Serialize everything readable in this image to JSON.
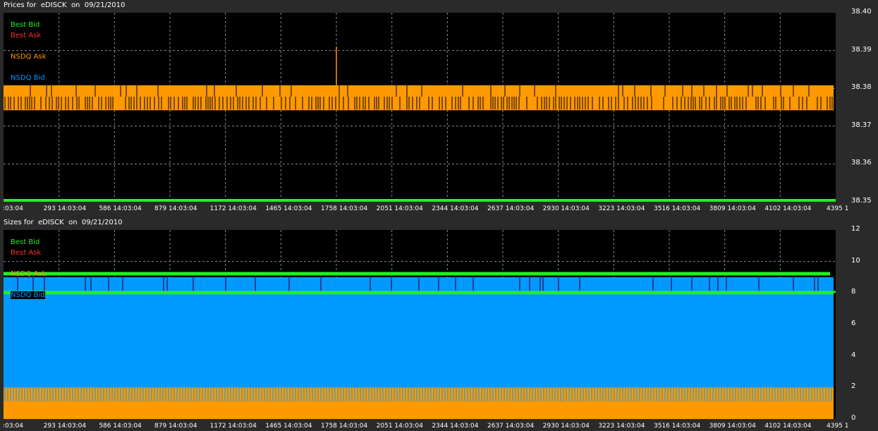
{
  "colors": {
    "background": "#2a2a2a",
    "plot_bg": "#000000",
    "grid": "#8a8a8a",
    "best_bid": "#22ee22",
    "best_ask": "#ff3030",
    "nsdq_ask": "#ff9900",
    "nsdq_bid": "#0099ff"
  },
  "chart_data": [
    {
      "type": "line",
      "title": "Prices for  eDISCK  on  09/21/2010",
      "legend": [
        "Best Bid",
        "Best Ask",
        "NSDQ Ask",
        "NSDQ Bid"
      ],
      "legend_placement": "top-left",
      "grid": true,
      "ylim": [
        38.35,
        38.4
      ],
      "y_ticks": [
        "38.40",
        "38.39",
        "38.38",
        "38.37",
        "38.36",
        "38.35"
      ],
      "x_ticks": [
        ":03:04",
        "293 14:03:04",
        "586 14:03:04",
        "879 14:03:04",
        "1172 14:03:04",
        "1465 14:03:04",
        "1758 14:03:04",
        "2051 14:03:04",
        "2344 14:03:04",
        "2637 14:03:04",
        "2930 14:03:04",
        "3223 14:03:04",
        "3516 14:03:04",
        "3809 14:03:04",
        "4102 14:03:04",
        "4395 1"
      ],
      "xlim": [
        0,
        4395
      ],
      "series": [
        {
          "name": "Best Bid",
          "values_summary": "constant at 38.35",
          "value": 38.35
        },
        {
          "name": "NSDQ Ask",
          "low": 38.375,
          "high": 38.38,
          "spike_x": 1758,
          "spike_value": 38.391
        },
        {
          "name": "NSDQ Bid",
          "value": 38.38
        }
      ]
    },
    {
      "type": "area",
      "title": "Sizes for  eDISCK  on  09/21/2010",
      "legend": [
        "Best Bid",
        "Best Ask",
        "NSDQ Ask",
        "NSDQ Bid"
      ],
      "legend_placement": "top-left",
      "grid": true,
      "ylim": [
        0,
        12
      ],
      "y_ticks": [
        "12",
        "10",
        "8",
        "6",
        "4",
        "2",
        "0"
      ],
      "x_ticks": [
        ":03:04",
        "293 14:03:04",
        "586 14:03:04",
        "879 14:03:04",
        "1172 14:03:04",
        "1465 14:03:04",
        "1758 14:03:04",
        "2051 14:03:04",
        "2344 14:03:04",
        "2637 14:03:04",
        "2930 14:03:04",
        "3223 14:03:04",
        "3516 14:03:04",
        "3809 14:03:04",
        "4102 14:03:04",
        "4395 1"
      ],
      "xlim": [
        0,
        4395
      ],
      "series": [
        {
          "name": "NSDQ Bid",
          "value_high": 9,
          "value_low": 8
        },
        {
          "name": "Best Bid",
          "upper": 9.2,
          "lower": 8.0
        },
        {
          "name": "NSDQ Ask",
          "value": 2
        }
      ]
    }
  ]
}
